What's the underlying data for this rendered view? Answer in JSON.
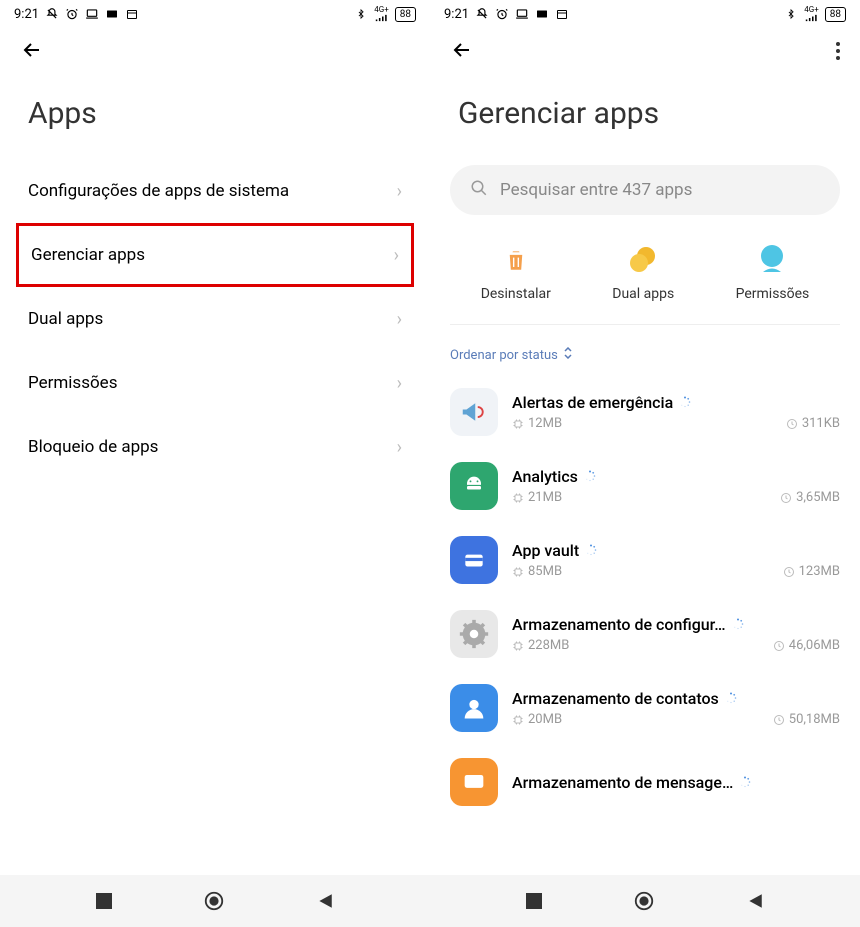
{
  "status": {
    "time": "9:21",
    "battery": "88",
    "signal_label": "4G+"
  },
  "left": {
    "title": "Apps",
    "items": [
      {
        "label": "Configurações de apps de sistema",
        "highlight": false
      },
      {
        "label": "Gerenciar apps",
        "highlight": true
      },
      {
        "label": "Dual apps",
        "highlight": false
      },
      {
        "label": "Permissões",
        "highlight": false
      },
      {
        "label": "Bloqueio de apps",
        "highlight": false
      }
    ]
  },
  "right": {
    "title": "Gerenciar apps",
    "search_placeholder": "Pesquisar entre 437 apps",
    "actions": [
      {
        "label": "Desinstalar",
        "icon": "trash",
        "color": "#f5a04c"
      },
      {
        "label": "Dual apps",
        "icon": "dual",
        "color": "#f7c948"
      },
      {
        "label": "Permissões",
        "icon": "perm",
        "color": "#4ec5e4"
      }
    ],
    "sort_label": "Ordenar por status",
    "apps": [
      {
        "name": "Alertas de emergência",
        "storage": "12MB",
        "data": "311KB",
        "icon_bg": "#f0f3f7",
        "icon_type": "megaphone"
      },
      {
        "name": "Analytics",
        "storage": "21MB",
        "data": "3,65MB",
        "icon_bg": "#2ea66f",
        "icon_type": "android"
      },
      {
        "name": "App vault",
        "storage": "85MB",
        "data": "123MB",
        "icon_bg": "#3e73e0",
        "icon_type": "card"
      },
      {
        "name": "Armazenamento de configur…",
        "storage": "228MB",
        "data": "46,06MB",
        "icon_bg": "#e8e8e8",
        "icon_type": "gear"
      },
      {
        "name": "Armazenamento de contatos",
        "storage": "20MB",
        "data": "50,18MB",
        "icon_bg": "#3b8de8",
        "icon_type": "contact"
      },
      {
        "name": "Armazenamento de mensage…",
        "storage": "",
        "data": "",
        "icon_bg": "#f79532",
        "icon_type": "message"
      }
    ]
  }
}
